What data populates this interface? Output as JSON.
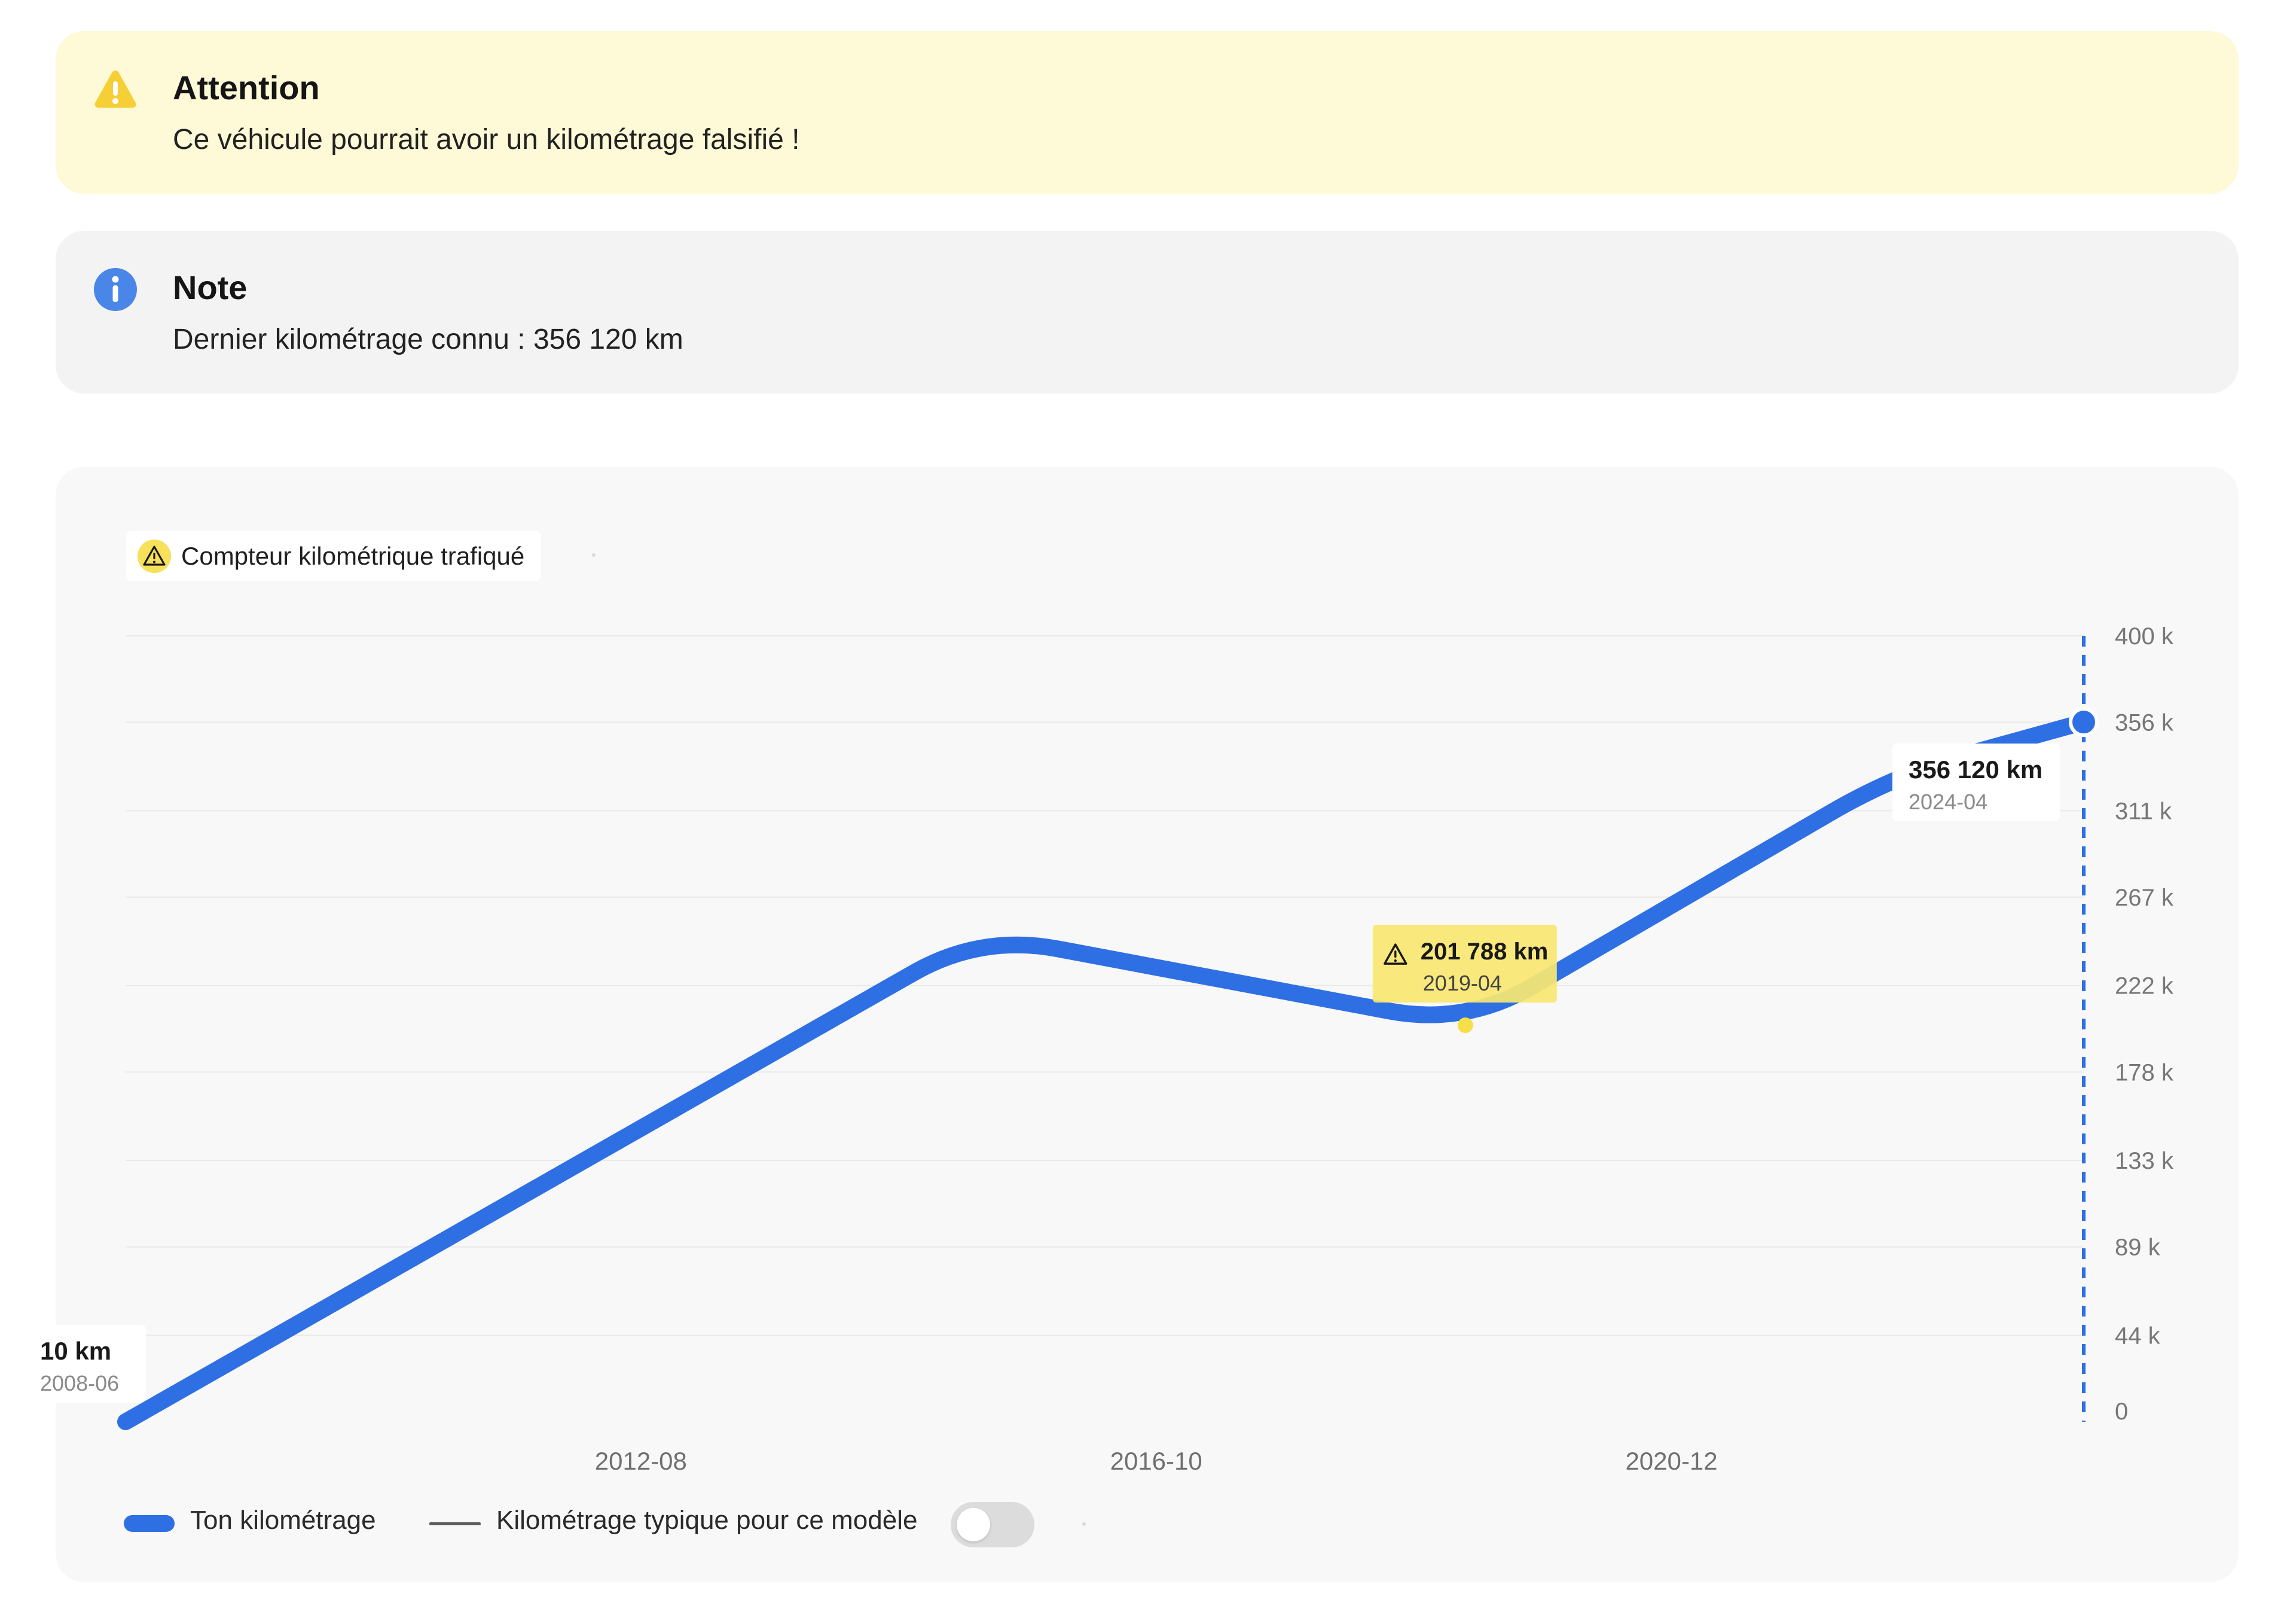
{
  "warning": {
    "title": "Attention",
    "message": "Ce véhicule pourrait avoir un kilométrage falsifié !",
    "icon": "warning-triangle-icon",
    "color": "#f6d03d"
  },
  "note": {
    "title": "Note",
    "message": "Dernier kilométrage connu : 356 120 km",
    "icon": "info-circle-icon",
    "color": "#4a86e8"
  },
  "tampered_chip": {
    "label": "Compteur kilométrique trafiqué",
    "icon": "warning-triangle-icon"
  },
  "legend": {
    "main_label": "Ton kilométrage",
    "typical_label": "Kilométrage typique pour ce modèle",
    "typical_toggle_on": false
  },
  "chart_data": {
    "type": "line",
    "x_unit": "date",
    "x_range": [
      "2008-06",
      "2024-04"
    ],
    "x_ticks": [
      "2012-08",
      "2016-10",
      "2020-12"
    ],
    "y_range": [
      0,
      400000
    ],
    "y_ticks": [
      0,
      44000,
      89000,
      133000,
      178000,
      222000,
      267000,
      311000,
      356000,
      400000
    ],
    "y_tick_labels": [
      "0",
      "44 k",
      "89 k",
      "133 k",
      "178 k",
      "222 k",
      "267 k",
      "311 k",
      "356 k",
      "400 k"
    ],
    "grid": true,
    "series": [
      {
        "name": "Ton kilométrage",
        "color": "#2f6fe4",
        "points": [
          {
            "x": "2008-06",
            "y": 10
          },
          {
            "x": "2015-05",
            "y": 248000
          },
          {
            "x": "2019-04",
            "y": 201788
          },
          {
            "x": "2022-10",
            "y": 330000
          },
          {
            "x": "2024-04",
            "y": 356120
          }
        ]
      }
    ],
    "annotations": [
      {
        "x": "2008-06",
        "y": 10,
        "value_label": "10 km",
        "date_label": "2008-06",
        "warning": false
      },
      {
        "x": "2019-04",
        "y": 201788,
        "value_label": "201 788 km",
        "date_label": "2019-04",
        "warning": true
      },
      {
        "x": "2024-04",
        "y": 356120,
        "value_label": "356 120 km",
        "date_label": "2024-04",
        "warning": false
      }
    ],
    "last_marker_x": "2024-04"
  }
}
